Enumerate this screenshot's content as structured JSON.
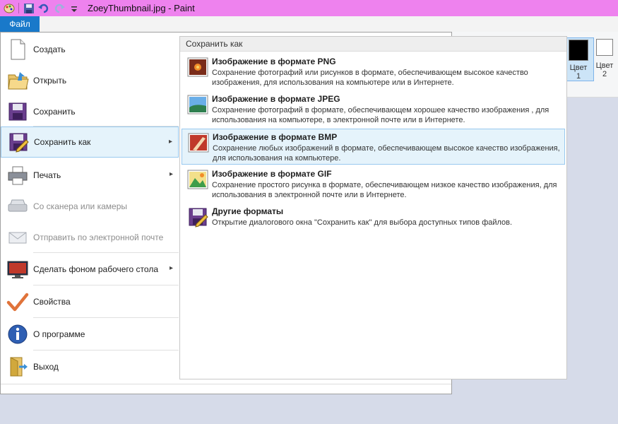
{
  "window": {
    "title": "ZoeyThumbnail.jpg - Paint"
  },
  "qat": {
    "icons": [
      "paint-app-icon",
      "save-icon",
      "undo-icon",
      "redo-icon",
      "customize-icon"
    ]
  },
  "file_tab": {
    "label": "Файл"
  },
  "colors": {
    "color1": {
      "label_line1": "Цвет",
      "label_line2": "1",
      "value": "#000000"
    },
    "color2": {
      "label_line1": "Цвет",
      "label_line2": "2",
      "value": "#ffffff"
    }
  },
  "menu": {
    "items": [
      {
        "label": "Создать",
        "icon": "new-file-icon"
      },
      {
        "label": "Открыть",
        "icon": "open-folder-icon"
      },
      {
        "label": "Сохранить",
        "icon": "save-icon"
      },
      {
        "label": "Сохранить как",
        "icon": "save-as-icon",
        "selected": true,
        "has_submenu": true
      },
      {
        "label": "Печать",
        "icon": "printer-icon",
        "has_submenu": true
      },
      {
        "label": "Со сканера или камеры",
        "icon": "scanner-icon",
        "disabled": true
      },
      {
        "label": "Отправить по электронной почте",
        "icon": "email-icon",
        "disabled": true
      },
      {
        "label": "Сделать фоном рабочего стола",
        "icon": "desktop-background-icon",
        "has_submenu": true
      },
      {
        "label": "Свойства",
        "icon": "properties-checkmark-icon"
      },
      {
        "label": "О программе",
        "icon": "info-icon"
      },
      {
        "label": "Выход",
        "icon": "exit-icon"
      }
    ]
  },
  "save_as_panel": {
    "header": "Сохранить как",
    "formats": [
      {
        "title": "Изображение в формате PNG",
        "desc": "Сохранение фотографий или рисунков в формате, обеспечивающем высокое качество изображения, для использования на компьютере или в Интернете.",
        "icon": "png-image-icon"
      },
      {
        "title": "Изображение в формате JPEG",
        "desc": "Сохранение фотографий в формате, обеспечивающем хорошее качество изображения , для использования на компьютере, в электронной почте или в Интернете.",
        "icon": "jpeg-image-icon"
      },
      {
        "title": "Изображение в формате BMP",
        "desc": "Сохранение любых изображений в формате, обеспечивающем высокое качество изображения, для использования на компьютере.",
        "icon": "bmp-image-icon",
        "selected": true
      },
      {
        "title": "Изображение в формате GIF",
        "desc": "Сохранение простого рисунка в формате, обеспечивающем низкое качество изображения, для использования в электронной почте или в Интернете.",
        "icon": "gif-image-icon"
      },
      {
        "title": "Другие форматы",
        "desc": "Открытие диалогового окна \"Сохранить как\" для выбора доступных типов файлов.",
        "icon": "other-formats-icon"
      }
    ]
  }
}
